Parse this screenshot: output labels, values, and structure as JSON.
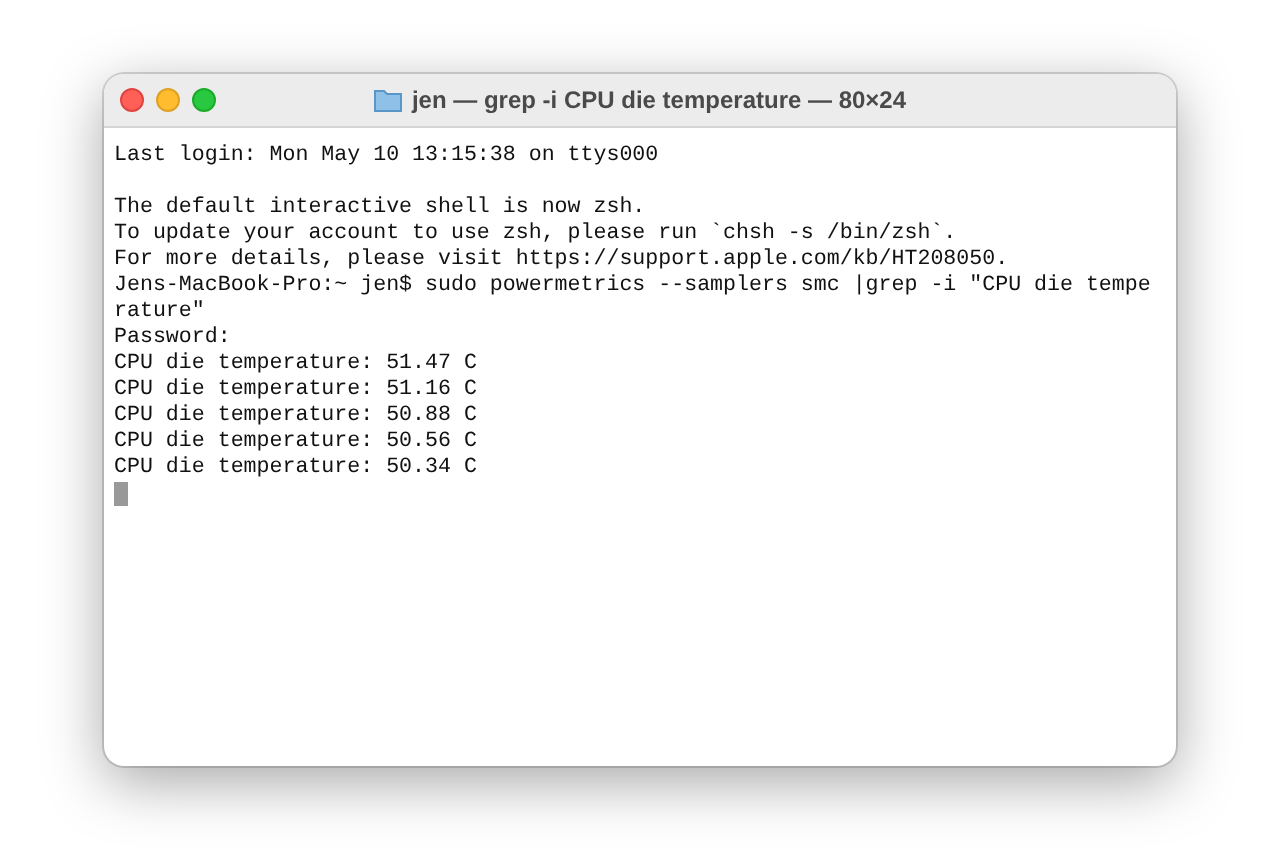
{
  "window": {
    "title": "jen — grep -i CPU die temperature — 80×24"
  },
  "terminal": {
    "blocks": [
      [
        "Last login: Mon May 10 13:15:38 on ttys000"
      ],
      [
        "The default interactive shell is now zsh.",
        "To update your account to use zsh, please run `chsh -s /bin/zsh`.",
        "For more details, please visit https://support.apple.com/kb/HT208050.",
        "Jens-MacBook-Pro:~ jen$ sudo powermetrics --samplers smc |grep -i \"CPU die tempe",
        "rature\"",
        "Password:",
        "CPU die temperature: 51.47 C",
        "CPU die temperature: 51.16 C",
        "CPU die temperature: 50.88 C",
        "CPU die temperature: 50.56 C",
        "CPU die temperature: 50.34 C"
      ]
    ]
  }
}
